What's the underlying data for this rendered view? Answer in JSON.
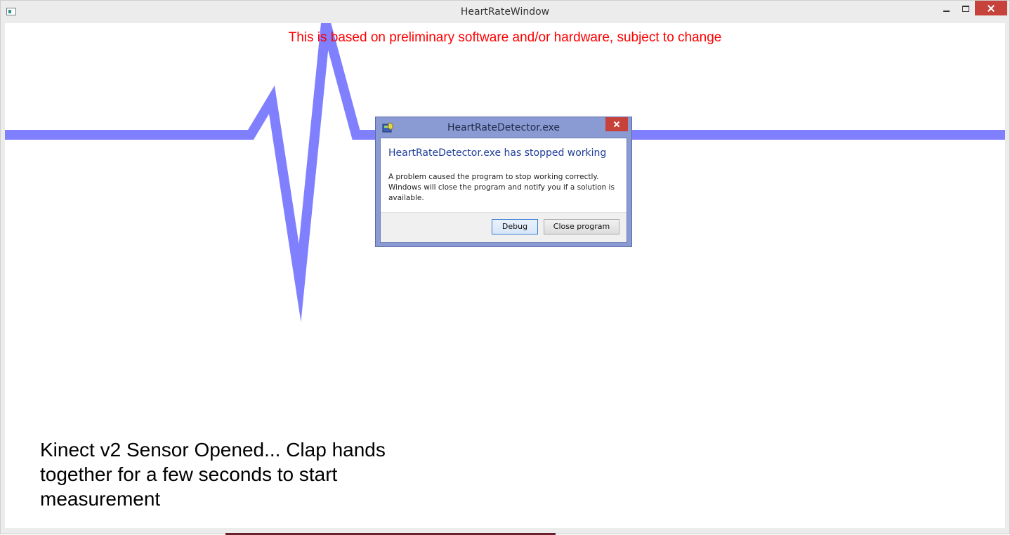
{
  "window": {
    "title": "HeartRateWindow"
  },
  "content": {
    "disclaimer": "This is based on preliminary software and/or hardware, subject to change",
    "status": "Kinect v2 Sensor Opened... Clap hands together for a few seconds to start measurement",
    "waveform_color": "#8080ff",
    "disclaimer_color": "#ff0000"
  },
  "dialog": {
    "title": "HeartRateDetector.exe",
    "heading": "HeartRateDetector.exe has stopped working",
    "message": "A problem caused the program to stop working correctly. Windows will close the program and notify you if a solution is available.",
    "debug_label": "Debug",
    "close_program_label": "Close program",
    "heading_color": "#1e3d99"
  },
  "icons": {
    "app": "window-app-icon",
    "dialog": "shield-error-icon"
  }
}
